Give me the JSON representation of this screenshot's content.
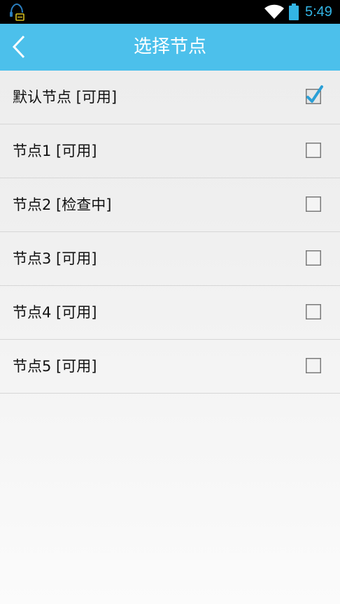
{
  "status_bar": {
    "time": "5:49",
    "accent_color": "#33b5e5",
    "icons": [
      "notification-icon",
      "wifi-icon",
      "battery-icon"
    ]
  },
  "title_bar": {
    "title": "选择节点",
    "background_color": "#4cc0eb",
    "back_icon": "chevron-left-icon"
  },
  "nodes": [
    {
      "label": "默认节点 [可用]",
      "checked": true
    },
    {
      "label": "节点1 [可用]",
      "checked": false
    },
    {
      "label": "节点2 [检查中]",
      "checked": false
    },
    {
      "label": "节点3 [可用]",
      "checked": false
    },
    {
      "label": "节点4 [可用]",
      "checked": false
    },
    {
      "label": "节点5 [可用]",
      "checked": false
    }
  ]
}
